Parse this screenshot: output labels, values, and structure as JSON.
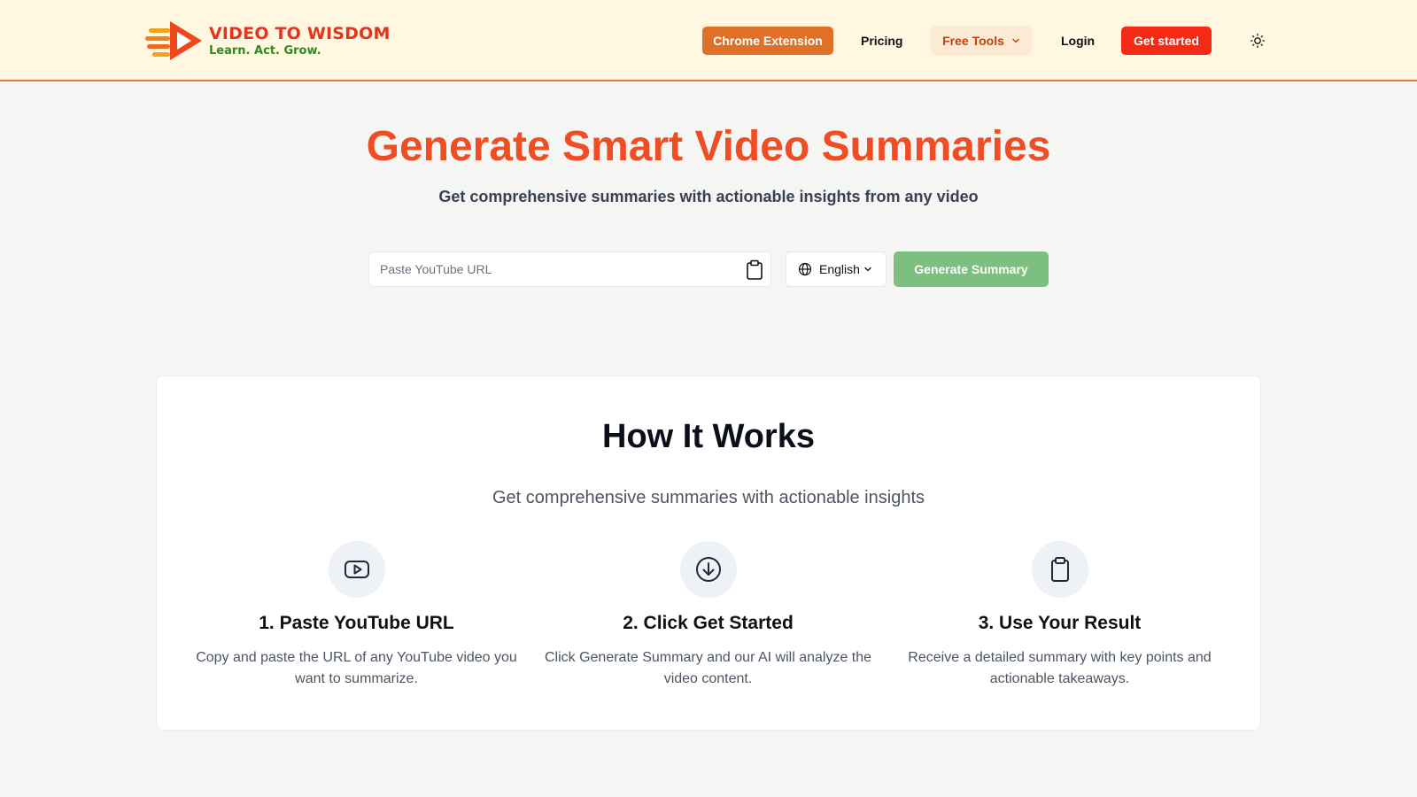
{
  "brand": {
    "name": "VIDEO TO WISDOM",
    "tagline": "Learn. Act. Grow.",
    "colors": {
      "orange": "#e07028",
      "red": "#f32b14",
      "green": "#7dbf7e",
      "header_bg": "#fff7e0"
    }
  },
  "nav": {
    "chrome_extension": "Chrome Extension",
    "pricing": "Pricing",
    "free_tools": "Free Tools",
    "login": "Login",
    "get_started": "Get started",
    "theme_icon": "sun-icon"
  },
  "hero": {
    "title": "Generate Smart Video Summaries",
    "subtitle": "Get comprehensive summaries with actionable insights from any video",
    "url_placeholder": "Paste YouTube URL",
    "url_value": "",
    "language": "English",
    "generate_label": "Generate Summary"
  },
  "how_it_works": {
    "title": "How It Works",
    "subtitle": "Get comprehensive summaries with actionable insights",
    "steps": [
      {
        "icon": "youtube-icon",
        "title": "1. Paste YouTube URL",
        "description": "Copy and paste the URL of any YouTube video you want to summarize."
      },
      {
        "icon": "arrow-down-circle-icon",
        "title": "2. Click Get Started",
        "description": "Click Generate Summary and our AI will analyze the video content."
      },
      {
        "icon": "clipboard-icon",
        "title": "3. Use Your Result",
        "description": "Receive a detailed summary with key points and actionable takeaways."
      }
    ]
  }
}
